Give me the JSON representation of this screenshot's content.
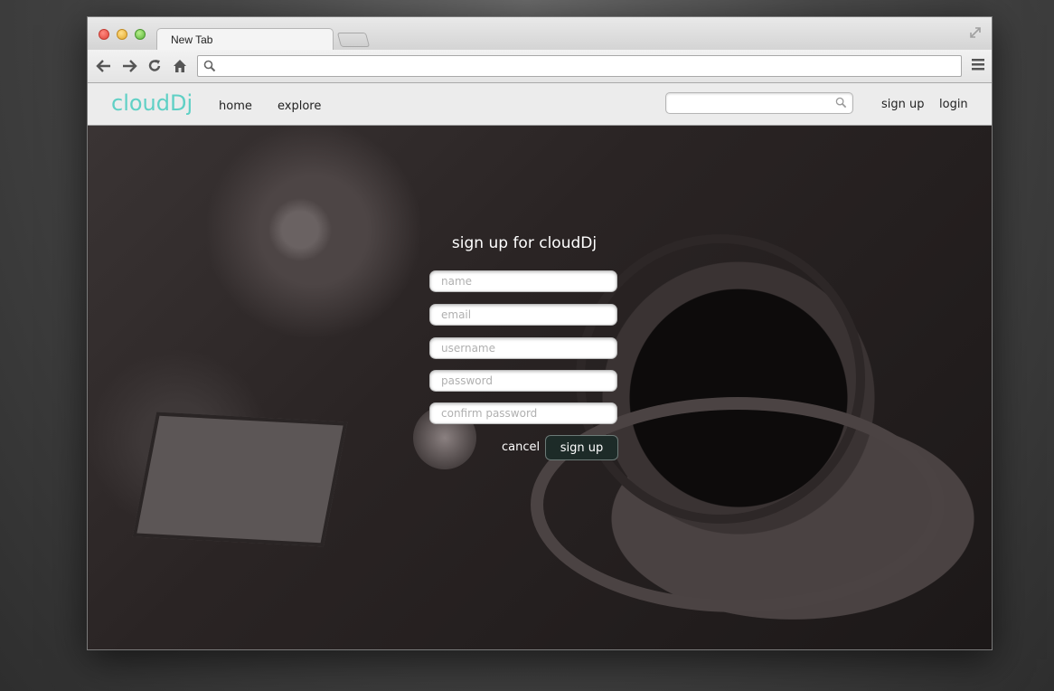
{
  "browser": {
    "tab_title": "New Tab",
    "address_value": ""
  },
  "site": {
    "logo": "cloudDj",
    "nav": {
      "home": "home",
      "explore": "explore",
      "sign_up": "sign up",
      "login": "login"
    },
    "search_placeholder": ""
  },
  "signup_form": {
    "title": "sign up for cloudDj",
    "fields": {
      "name": "name",
      "email": "email",
      "username": "username",
      "password": "password",
      "confirm_password": "confirm password"
    },
    "cancel_label": "cancel",
    "submit_label": "sign up"
  },
  "colors": {
    "logo": "#5fd0c5",
    "submit_bg": "#1d2b28"
  }
}
